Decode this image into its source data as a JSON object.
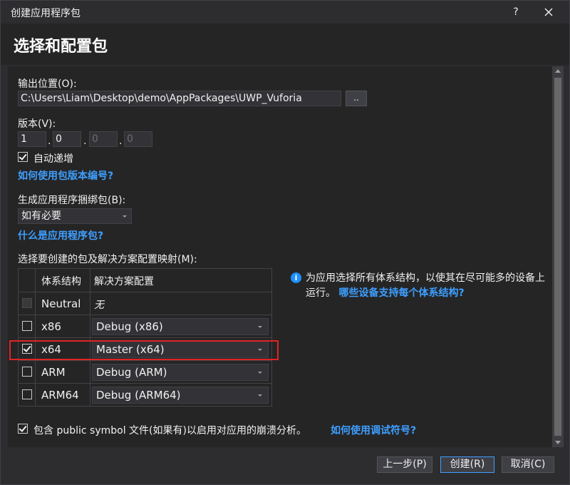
{
  "window": {
    "title": "创建应用程序包",
    "help_label": "?"
  },
  "header": {
    "title": "选择和配置包"
  },
  "output": {
    "label": "输出位置(O):",
    "value": "C:\\Users\\Liam\\Desktop\\demo\\AppPackages\\UWP_Vuforia",
    "browse_label": ".."
  },
  "version": {
    "label": "版本(V):",
    "parts": [
      "1",
      "0",
      "0",
      "0"
    ],
    "auto_increment_label": "自动递增",
    "auto_increment_checked": true,
    "help_link": "如何使用包版本编号?"
  },
  "bundle": {
    "label": "生成应用程序捆绑包(B):",
    "selected": "如有必要",
    "help_link": "什么是应用程序包?"
  },
  "mapping": {
    "label": "选择要创建的包及解决方案配置映射(M):",
    "columns": [
      "体系结构",
      "解决方案配置"
    ],
    "rows": [
      {
        "arch": "Neutral",
        "config": "无",
        "checked": false,
        "disabled": true
      },
      {
        "arch": "x86",
        "config": "Debug (x86)",
        "checked": false,
        "disabled": false
      },
      {
        "arch": "x64",
        "config": "Master (x64)",
        "checked": true,
        "disabled": false
      },
      {
        "arch": "ARM",
        "config": "Debug (ARM)",
        "checked": false,
        "disabled": false
      },
      {
        "arch": "ARM64",
        "config": "Debug (ARM64)",
        "checked": false,
        "disabled": false
      }
    ]
  },
  "info": {
    "text": "为应用选择所有体系结构，以使其在尽可能多的设备上运行。",
    "link": "哪些设备支持每个体系结构?"
  },
  "symbols": {
    "label": "包含 public symbol 文件(如果有)以启用对应用的崩溃分析。",
    "checked": true,
    "link": "如何使用调试符号?"
  },
  "footer": {
    "back_label": "上一步(P)",
    "create_label": "创建(R)",
    "cancel_label": "取消(C)"
  },
  "colors": {
    "accent": "#3e9fff",
    "highlight": "#e02424",
    "background": "#252526"
  }
}
